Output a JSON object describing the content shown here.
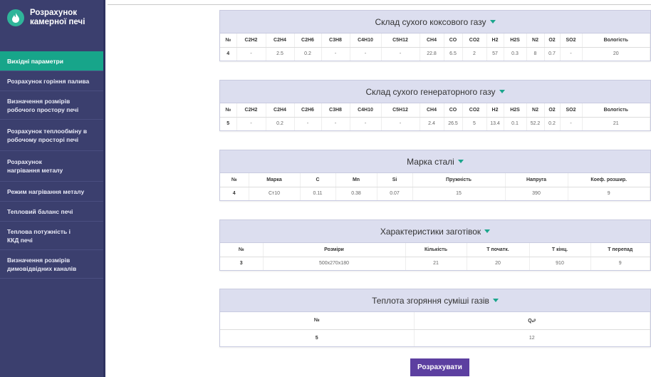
{
  "sidebar": {
    "title_line1": "Розрахунок",
    "title_line2": "камерної печі",
    "items": [
      {
        "label": "Вихідні параметри"
      },
      {
        "label": "Розрахунок горіння палива"
      },
      {
        "label": "Визначення розмірів робочого простору печі"
      },
      {
        "label": "Розрахунок теплообміну в робочому просторі печі"
      },
      {
        "label": "Розрахунок нагрівання металу"
      },
      {
        "label": "Режим нагрівання металу"
      },
      {
        "label": "Тепловий баланс печі"
      },
      {
        "label": "Теплова потужність і ККД печі"
      },
      {
        "label": "Визначення розмірів димовідвідних каналів"
      }
    ]
  },
  "coke_gas": {
    "title": "Склад сухого коксового газу",
    "headers": [
      "№",
      "C2H2",
      "C2H4",
      "C2H6",
      "C3H8",
      "C4H10",
      "C5H12",
      "CH4",
      "CO",
      "CO2",
      "H2",
      "H2S",
      "N2",
      "O2",
      "SO2",
      "Вологість"
    ],
    "row": [
      "4",
      "-",
      "2.5",
      "0.2",
      "-",
      "-",
      "-",
      "22.8",
      "6.5",
      "2",
      "57",
      "0.3",
      "8",
      "0.7",
      "-",
      "20"
    ]
  },
  "gen_gas": {
    "title": "Склад сухого генераторного газу",
    "headers": [
      "№",
      "C2H2",
      "C2H4",
      "C2H6",
      "C3H8",
      "C4H10",
      "C5H12",
      "CH4",
      "CO",
      "CO2",
      "H2",
      "H2S",
      "N2",
      "O2",
      "SO2",
      "Вологість"
    ],
    "row": [
      "5",
      "-",
      "0.2",
      "-",
      "-",
      "-",
      "-",
      "2.4",
      "26.5",
      "5",
      "13.4",
      "0.1",
      "52.2",
      "0.2",
      "-",
      "21"
    ]
  },
  "steel": {
    "title": "Марка сталі",
    "headers": [
      "№",
      "Марка",
      "C",
      "Mn",
      "Si",
      "Пружність",
      "Напруга",
      "Коеф. розшир."
    ],
    "row": [
      "4",
      "Ст10",
      "0.11",
      "0.38",
      "0.07",
      "15",
      "390",
      "9"
    ]
  },
  "billets": {
    "title": "Характеристики заготівок",
    "headers": [
      "№",
      "Розміри",
      "Кількість",
      "Т початк.",
      "Т кінц.",
      "Т перепад"
    ],
    "row": [
      "3",
      "500x270x180",
      "21",
      "20",
      "910",
      "9"
    ]
  },
  "heat": {
    "title": "Теплота згоряння суміші газів",
    "headers": [
      "№",
      "Qₙᵖ"
    ],
    "row": [
      "5",
      "12"
    ]
  },
  "calculate_label": "Розрахувати",
  "colors": {
    "sidebar": "#3b3f6e",
    "active": "#17a58a",
    "button": "#5c3fa0",
    "panel_head": "#dcdeef"
  }
}
